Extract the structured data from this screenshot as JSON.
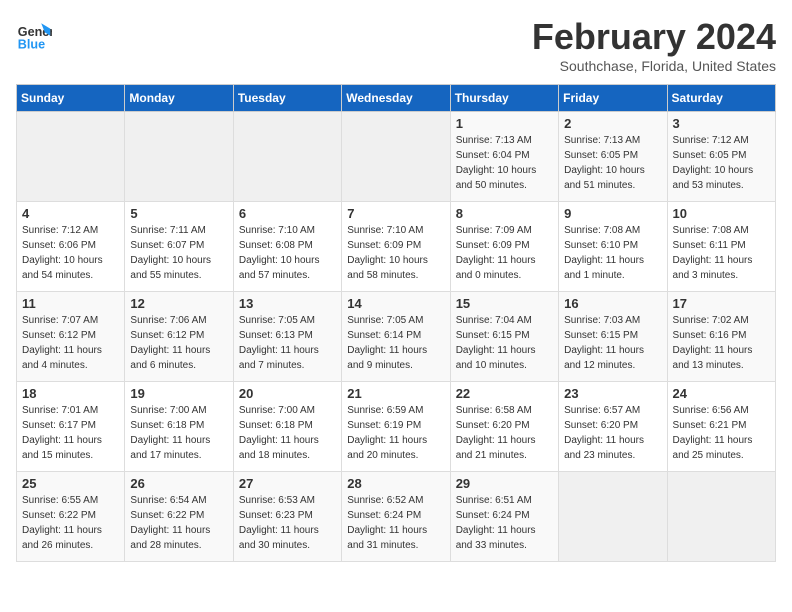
{
  "header": {
    "logo_line1": "General",
    "logo_line2": "Blue",
    "title": "February 2024",
    "subtitle": "Southchase, Florida, United States"
  },
  "calendar": {
    "days_of_week": [
      "Sunday",
      "Monday",
      "Tuesday",
      "Wednesday",
      "Thursday",
      "Friday",
      "Saturday"
    ],
    "weeks": [
      [
        {
          "day": "",
          "info": ""
        },
        {
          "day": "",
          "info": ""
        },
        {
          "day": "",
          "info": ""
        },
        {
          "day": "",
          "info": ""
        },
        {
          "day": "1",
          "info": "Sunrise: 7:13 AM\nSunset: 6:04 PM\nDaylight: 10 hours\nand 50 minutes."
        },
        {
          "day": "2",
          "info": "Sunrise: 7:13 AM\nSunset: 6:05 PM\nDaylight: 10 hours\nand 51 minutes."
        },
        {
          "day": "3",
          "info": "Sunrise: 7:12 AM\nSunset: 6:05 PM\nDaylight: 10 hours\nand 53 minutes."
        }
      ],
      [
        {
          "day": "4",
          "info": "Sunrise: 7:12 AM\nSunset: 6:06 PM\nDaylight: 10 hours\nand 54 minutes."
        },
        {
          "day": "5",
          "info": "Sunrise: 7:11 AM\nSunset: 6:07 PM\nDaylight: 10 hours\nand 55 minutes."
        },
        {
          "day": "6",
          "info": "Sunrise: 7:10 AM\nSunset: 6:08 PM\nDaylight: 10 hours\nand 57 minutes."
        },
        {
          "day": "7",
          "info": "Sunrise: 7:10 AM\nSunset: 6:09 PM\nDaylight: 10 hours\nand 58 minutes."
        },
        {
          "day": "8",
          "info": "Sunrise: 7:09 AM\nSunset: 6:09 PM\nDaylight: 11 hours\nand 0 minutes."
        },
        {
          "day": "9",
          "info": "Sunrise: 7:08 AM\nSunset: 6:10 PM\nDaylight: 11 hours\nand 1 minute."
        },
        {
          "day": "10",
          "info": "Sunrise: 7:08 AM\nSunset: 6:11 PM\nDaylight: 11 hours\nand 3 minutes."
        }
      ],
      [
        {
          "day": "11",
          "info": "Sunrise: 7:07 AM\nSunset: 6:12 PM\nDaylight: 11 hours\nand 4 minutes."
        },
        {
          "day": "12",
          "info": "Sunrise: 7:06 AM\nSunset: 6:12 PM\nDaylight: 11 hours\nand 6 minutes."
        },
        {
          "day": "13",
          "info": "Sunrise: 7:05 AM\nSunset: 6:13 PM\nDaylight: 11 hours\nand 7 minutes."
        },
        {
          "day": "14",
          "info": "Sunrise: 7:05 AM\nSunset: 6:14 PM\nDaylight: 11 hours\nand 9 minutes."
        },
        {
          "day": "15",
          "info": "Sunrise: 7:04 AM\nSunset: 6:15 PM\nDaylight: 11 hours\nand 10 minutes."
        },
        {
          "day": "16",
          "info": "Sunrise: 7:03 AM\nSunset: 6:15 PM\nDaylight: 11 hours\nand 12 minutes."
        },
        {
          "day": "17",
          "info": "Sunrise: 7:02 AM\nSunset: 6:16 PM\nDaylight: 11 hours\nand 13 minutes."
        }
      ],
      [
        {
          "day": "18",
          "info": "Sunrise: 7:01 AM\nSunset: 6:17 PM\nDaylight: 11 hours\nand 15 minutes."
        },
        {
          "day": "19",
          "info": "Sunrise: 7:00 AM\nSunset: 6:18 PM\nDaylight: 11 hours\nand 17 minutes."
        },
        {
          "day": "20",
          "info": "Sunrise: 7:00 AM\nSunset: 6:18 PM\nDaylight: 11 hours\nand 18 minutes."
        },
        {
          "day": "21",
          "info": "Sunrise: 6:59 AM\nSunset: 6:19 PM\nDaylight: 11 hours\nand 20 minutes."
        },
        {
          "day": "22",
          "info": "Sunrise: 6:58 AM\nSunset: 6:20 PM\nDaylight: 11 hours\nand 21 minutes."
        },
        {
          "day": "23",
          "info": "Sunrise: 6:57 AM\nSunset: 6:20 PM\nDaylight: 11 hours\nand 23 minutes."
        },
        {
          "day": "24",
          "info": "Sunrise: 6:56 AM\nSunset: 6:21 PM\nDaylight: 11 hours\nand 25 minutes."
        }
      ],
      [
        {
          "day": "25",
          "info": "Sunrise: 6:55 AM\nSunset: 6:22 PM\nDaylight: 11 hours\nand 26 minutes."
        },
        {
          "day": "26",
          "info": "Sunrise: 6:54 AM\nSunset: 6:22 PM\nDaylight: 11 hours\nand 28 minutes."
        },
        {
          "day": "27",
          "info": "Sunrise: 6:53 AM\nSunset: 6:23 PM\nDaylight: 11 hours\nand 30 minutes."
        },
        {
          "day": "28",
          "info": "Sunrise: 6:52 AM\nSunset: 6:24 PM\nDaylight: 11 hours\nand 31 minutes."
        },
        {
          "day": "29",
          "info": "Sunrise: 6:51 AM\nSunset: 6:24 PM\nDaylight: 11 hours\nand 33 minutes."
        },
        {
          "day": "",
          "info": ""
        },
        {
          "day": "",
          "info": ""
        }
      ]
    ]
  }
}
